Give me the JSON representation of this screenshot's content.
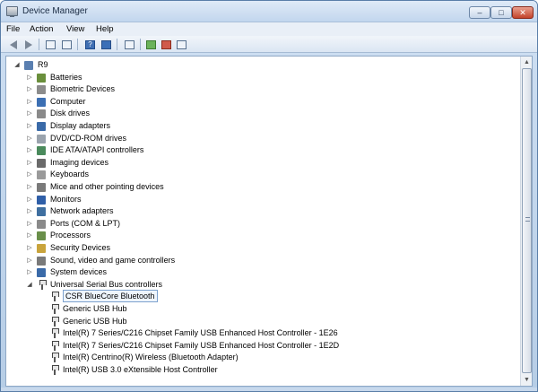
{
  "window": {
    "title": "Device Manager"
  },
  "controls": {
    "minimize": "–",
    "maximize": "□",
    "close": "✕"
  },
  "menu": {
    "items": [
      "File",
      "Action",
      "View",
      "Help"
    ]
  },
  "toolbar": {
    "icons": [
      "back-icon",
      "forward-icon",
      "show-hide-tree-icon",
      "properties-icon",
      "help-icon",
      "properties-pane-icon",
      "scan-hardware-icon",
      "update-driver-icon",
      "uninstall-icon",
      "disable-icon"
    ]
  },
  "tree": {
    "root": "R9",
    "categories": [
      {
        "label": "Batteries",
        "icon": "battery-icon",
        "color": "#6a8f3c"
      },
      {
        "label": "Biometric Devices",
        "icon": "fingerprint-icon",
        "color": "#8c8c8c"
      },
      {
        "label": "Computer",
        "icon": "computer-icon",
        "color": "#3c6fb3"
      },
      {
        "label": "Disk drives",
        "icon": "disk-icon",
        "color": "#8a8a8a"
      },
      {
        "label": "Display adapters",
        "icon": "display-adapter-icon",
        "color": "#3a6aa8"
      },
      {
        "label": "DVD/CD-ROM drives",
        "icon": "dvd-icon",
        "color": "#9aa3ad"
      },
      {
        "label": "IDE ATA/ATAPI controllers",
        "icon": "ide-icon",
        "color": "#4a8a5c"
      },
      {
        "label": "Imaging devices",
        "icon": "camera-icon",
        "color": "#6a6a6a"
      },
      {
        "label": "Keyboards",
        "icon": "keyboard-icon",
        "color": "#9a9a9a"
      },
      {
        "label": "Mice and other pointing devices",
        "icon": "mouse-icon",
        "color": "#7a7a7a"
      },
      {
        "label": "Monitors",
        "icon": "monitor-icon",
        "color": "#2f5fa8"
      },
      {
        "label": "Network adapters",
        "icon": "network-icon",
        "color": "#3f6fa0"
      },
      {
        "label": "Ports (COM & LPT)",
        "icon": "port-icon",
        "color": "#8a8a8a"
      },
      {
        "label": "Processors",
        "icon": "processor-icon",
        "color": "#6a8f4a"
      },
      {
        "label": "Security Devices",
        "icon": "security-icon",
        "color": "#c9a43c"
      },
      {
        "label": "Sound, video and game controllers",
        "icon": "sound-icon",
        "color": "#7a7a7a"
      },
      {
        "label": "System devices",
        "icon": "system-icon",
        "color": "#3a6aa8"
      },
      {
        "label": "Universal Serial Bus controllers",
        "icon": "usb-icon",
        "color": "#555555",
        "expanded": true
      }
    ],
    "usb_children": [
      {
        "label": "CSR BlueCore Bluetooth",
        "selected": true
      },
      {
        "label": "Generic USB Hub"
      },
      {
        "label": "Generic USB Hub"
      },
      {
        "label": "Intel(R) 7 Series/C216 Chipset Family USB Enhanced Host Controller - 1E26"
      },
      {
        "label": "Intel(R) 7 Series/C216 Chipset Family USB Enhanced Host Controller - 1E2D"
      },
      {
        "label": "Intel(R) Centrino(R) Wireless (Bluetooth Adapter)"
      },
      {
        "label": "Intel(R) USB 3.0 eXtensible Host Controller"
      }
    ]
  }
}
